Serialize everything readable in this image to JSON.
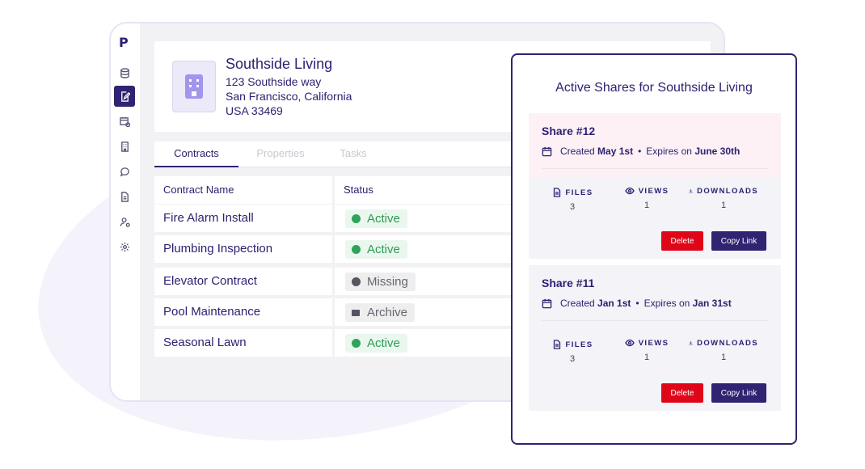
{
  "app": {
    "logo": "P"
  },
  "sidebar": {
    "items": [
      {
        "icon": "database-icon",
        "active": false
      },
      {
        "icon": "contract-sign-icon",
        "active": true
      },
      {
        "icon": "calendar-clock-icon",
        "active": false
      },
      {
        "icon": "building-icon",
        "active": false
      },
      {
        "icon": "chat-icon",
        "active": false
      },
      {
        "icon": "document-icon",
        "active": false
      },
      {
        "icon": "user-settings-icon",
        "active": false
      },
      {
        "icon": "gear-icon",
        "active": false
      }
    ]
  },
  "property": {
    "name": "Southside Living",
    "address_line1": "123 Southside way",
    "address_line2": "San Francisco, California",
    "address_line3": "USA 33469"
  },
  "tabs": [
    "Contracts",
    "Properties",
    "Tasks"
  ],
  "table": {
    "headers": [
      "Contract Name",
      "Status"
    ],
    "rows": [
      {
        "name": "Fire Alarm Install",
        "status": "Active"
      },
      {
        "name": "Plumbing Inspection",
        "status": "Active"
      },
      {
        "name": "Elevator Contract",
        "status": "Missing"
      },
      {
        "name": "Pool Maintenance",
        "status": "Archive"
      },
      {
        "name": "Seasonal Lawn",
        "status": "Active"
      }
    ]
  },
  "modal": {
    "title": "Active Shares for Southside Living",
    "stat_labels": {
      "files": "FILES",
      "views": "VIEWS",
      "downloads": "DOWNLOADS"
    },
    "created_label": "Created",
    "expires_label": "Expires on",
    "delete_label": "Delete",
    "copy_label": "Copy Link",
    "shares": [
      {
        "name": "Share #12",
        "created": "May 1st",
        "expires": "June 30th",
        "files": "3",
        "views": "1",
        "downloads": "1"
      },
      {
        "name": "Share #11",
        "created": "Jan 1st",
        "expires": "Jan 31st",
        "files": "3",
        "views": "1",
        "downloads": "1"
      }
    ]
  },
  "colors": {
    "brand": "#2f2372",
    "delete": "#e0061a",
    "active_status": "#2f9a55",
    "highlight_share": "#fdf1f5"
  }
}
